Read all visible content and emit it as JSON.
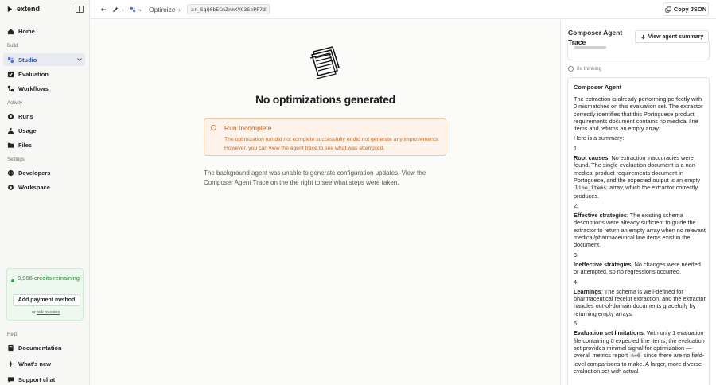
{
  "brand": {
    "name": "extend"
  },
  "sidebar": {
    "home": "Home",
    "build_label": "Build",
    "studio": "Studio",
    "evaluation": "Evaluation",
    "workflows": "Workflows",
    "activity_label": "Activity",
    "runs": "Runs",
    "usage": "Usage",
    "files": "Files",
    "settings_label": "Settings",
    "developers": "Developers",
    "workspace": "Workspace",
    "credits": "9,968 credits remaining",
    "payment_button": "Add payment method",
    "or_text": "or",
    "talk_link": "talk to sales",
    "help_label": "Help",
    "documentation": "Documentation",
    "whats_new": "What's new",
    "support_chat": "Support chat"
  },
  "topbar": {
    "page": "Optimize",
    "run_id": "ar_SqQ0bECmZnmKVG3SoPF7d",
    "copy_json": "Copy JSON"
  },
  "main": {
    "title": "No optimizations generated",
    "alert_title": "Run Incomplete",
    "alert_body": "The optimization run did not complete successfully or did not generate any improvements. However, you can view the agent trace to see what was attempted.",
    "explanation": "The background agent was unable to generate configuration updates. View the Composer Agent Trace on the the right to see what steps were taken."
  },
  "panel": {
    "title": "Composer Agent Trace",
    "summary_button": "View agent summary",
    "thinking": "8s thinking",
    "agent_label": "Composer Agent",
    "intro": "The extraction is already performing perfectly with 0 mismatches on this evaluation set. The extractor correctly identifies that this Portuguese product requirements document contains no medical line items and returns an empty array.",
    "summary_lead": "Here is a summary:",
    "n1": "1.",
    "root_label": "Root causes",
    "root_a": ": No extraction inaccuracies were found. The single evaluation document is a non-medical product requirements document in Portuguese, and the expected output is an empty",
    "root_code": "line_items",
    "root_b": "array, which the extractor correctly produces.",
    "n2": "2.",
    "eff_label": "Effective strategies",
    "eff_text": ": The existing schema descriptions were already sufficient to guide the extractor to return an empty array when no relevant medical/pharmaceutical line items exist in the document.",
    "n3": "3.",
    "ineff_label": "Ineffective strategies",
    "ineff_text": ": No changes were needed or attempted, so no regressions occurred.",
    "n4": "4.",
    "learn_label": "Learnings",
    "learn_text": ": The schema is well-defined for pharmaceutical receipt extraction, and the extractor handles out-of-domain documents gracefully by returning empty arrays.",
    "n5": "5.",
    "evalset_label": "Evaluation set limitations",
    "evalset_a": ": With only 1 evaluation file containing 0 expected line items, the evaluation set provides minimal signal for optimization — overall metrics report",
    "evalset_code": "n=0",
    "evalset_b": "since there are no field-level comparisons to make. A larger, more diverse evaluation set with actual"
  }
}
